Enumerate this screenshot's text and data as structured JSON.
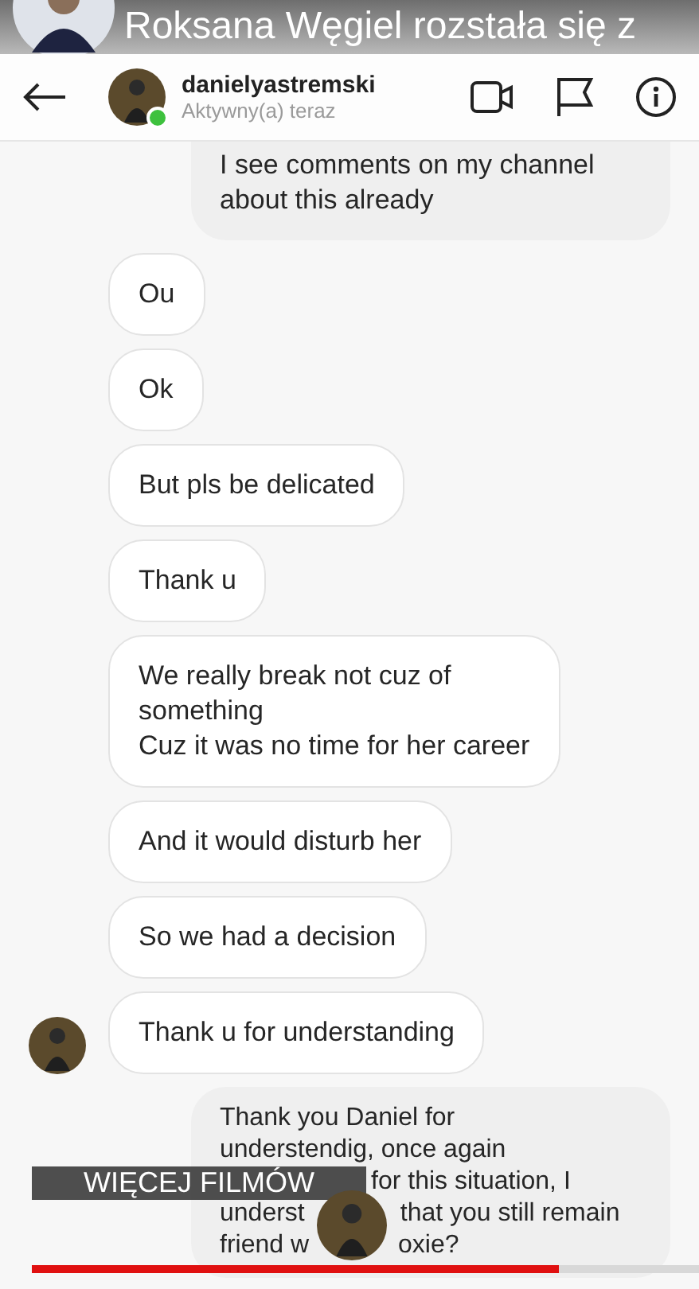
{
  "video_title": "Roksana Węgiel rozstała się z",
  "chat_header": {
    "username": "danielyastremski",
    "status": "Aktywny(a) teraz",
    "online": true
  },
  "messages": [
    {
      "kind": "sent",
      "lines": [
        "I see comments on my channel",
        "about this already"
      ],
      "avatar": false
    },
    {
      "kind": "received",
      "lines": [
        "Ou"
      ],
      "avatar": false
    },
    {
      "kind": "received",
      "lines": [
        "Ok"
      ],
      "avatar": false
    },
    {
      "kind": "received",
      "lines": [
        "But pls be delicated"
      ],
      "avatar": false
    },
    {
      "kind": "received",
      "lines": [
        "Thank u"
      ],
      "avatar": false
    },
    {
      "kind": "received",
      "lines": [
        "We really break not cuz of",
        "something",
        "Cuz it was no time for her career"
      ],
      "avatar": false
    },
    {
      "kind": "received",
      "lines": [
        "And it would disturb her"
      ],
      "avatar": false
    },
    {
      "kind": "received",
      "lines": [
        "So we had a decision"
      ],
      "avatar": false
    },
    {
      "kind": "received",
      "lines": [
        "Thank u for understanding"
      ],
      "avatar": true
    },
    {
      "kind": "sent",
      "lines": [
        "Thank you Daniel for",
        "understendig, once again",
        "for this situation, I",
        "underst",
        "that you still remain",
        "friend w",
        "oxie?"
      ],
      "avatar": false
    }
  ],
  "more_videos_button": "WIĘCEJ FILMÓW",
  "progress": {
    "level": 0.79
  }
}
